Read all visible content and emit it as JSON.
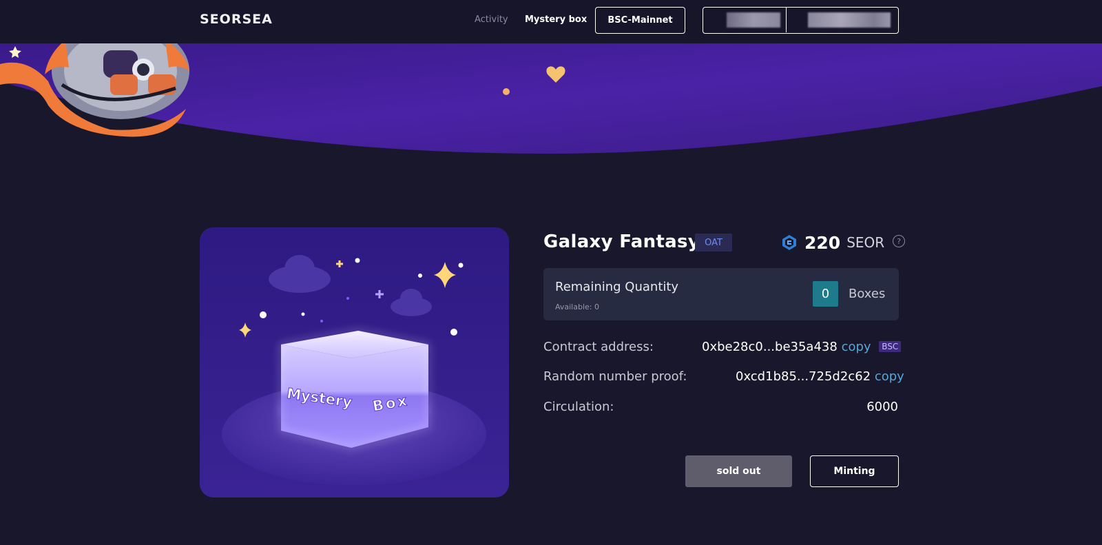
{
  "header": {
    "logo": "SEORSEA",
    "nav": {
      "activity": "Activity",
      "mystery_box": "Mystery box"
    },
    "network_button": "BSC-Mainnet"
  },
  "product": {
    "title": "Galaxy Fantasy",
    "tag": "OAT",
    "price": {
      "value": "220",
      "unit": "SEOR",
      "icon": "seor-token-icon",
      "help_icon": "?"
    },
    "remaining": {
      "label": "Remaining Quantity",
      "available": "Available: 0",
      "quantity": "0",
      "unit": "Boxes"
    },
    "contract": {
      "label": "Contract address:",
      "value": "0xbe28c0...be35a438",
      "copy": "copy",
      "chain": "BSC"
    },
    "proof": {
      "label": "Random number proof:",
      "value": "0xcd1b85...725d2c62",
      "copy": "copy"
    },
    "circulation": {
      "label": "Circulation:",
      "value": "6000"
    }
  },
  "mystery_box_art": {
    "left_face": "Mystery",
    "right_face": "Box"
  },
  "actions": {
    "sold_out": "sold out",
    "minting": "Minting"
  },
  "colors": {
    "background": "#19172b",
    "card": "#34208a",
    "accent_teal": "#1e7b8c",
    "copy_link": "#58a6d8",
    "oat_text": "#6f8cf2"
  }
}
